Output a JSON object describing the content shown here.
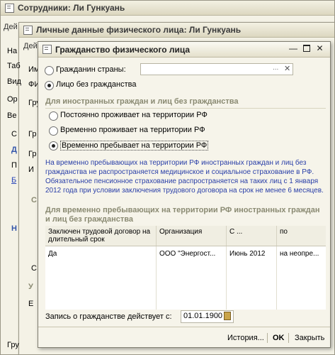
{
  "outer_window": {
    "title": "Сотрудники: Ли Гункуань",
    "tab_stub": "Дей"
  },
  "middle_window": {
    "title": "Личные данные физического лица: Ли Гункуань",
    "tab_stub": "Дей"
  },
  "background_stubs": {
    "left": [
      "На",
      "Таб",
      "Вид",
      "Ор",
      "Ве",
      "Ви",
      "С",
      "Гр",
      "Д",
      "П",
      "Б",
      "Гр",
      "И",
      "Н",
      "С",
      "С",
      "У",
      "Е",
      "Гру"
    ],
    "middle": [
      "Им",
      "ФИ",
      "Гру"
    ]
  },
  "dialog": {
    "title": "Гражданство физического лица",
    "citizen_label": "Гражданин страны:",
    "country_value": "",
    "stateless_label": "Лицо без гражданства",
    "section1": "Для иностранных граждан и лиц без гражданства",
    "options": [
      "Постоянно проживает на территории РФ",
      "Временно проживает на территории РФ",
      "Временно пребывает на территории РФ"
    ],
    "info": "На временно пребывающих на территории РФ иностранных граждан и лиц без гражданства не распространяется медицинское и социальное страхование в РФ. Обязательное пенсионное страхование распространяется на таких лиц с 1 января 2012 года при условии заключения трудового договора на срок не менее 6 месяцев.",
    "section2": "Для временно пребывающих на территории РФ иностранных граждан и лиц без гражданства",
    "table": {
      "headers": [
        "Заключен трудовой договор на длительный срок",
        "Организация",
        "С ...",
        "по"
      ],
      "rows": [
        [
          "Да",
          "ООО \"Энергост...",
          "Июнь 2012",
          "на неопре..."
        ]
      ]
    },
    "record_label": "Запись о гражданстве действует с:",
    "record_date": "01.01.1900",
    "history_button": "История...",
    "ok_button": "OK",
    "close_button": "Закрыть"
  }
}
